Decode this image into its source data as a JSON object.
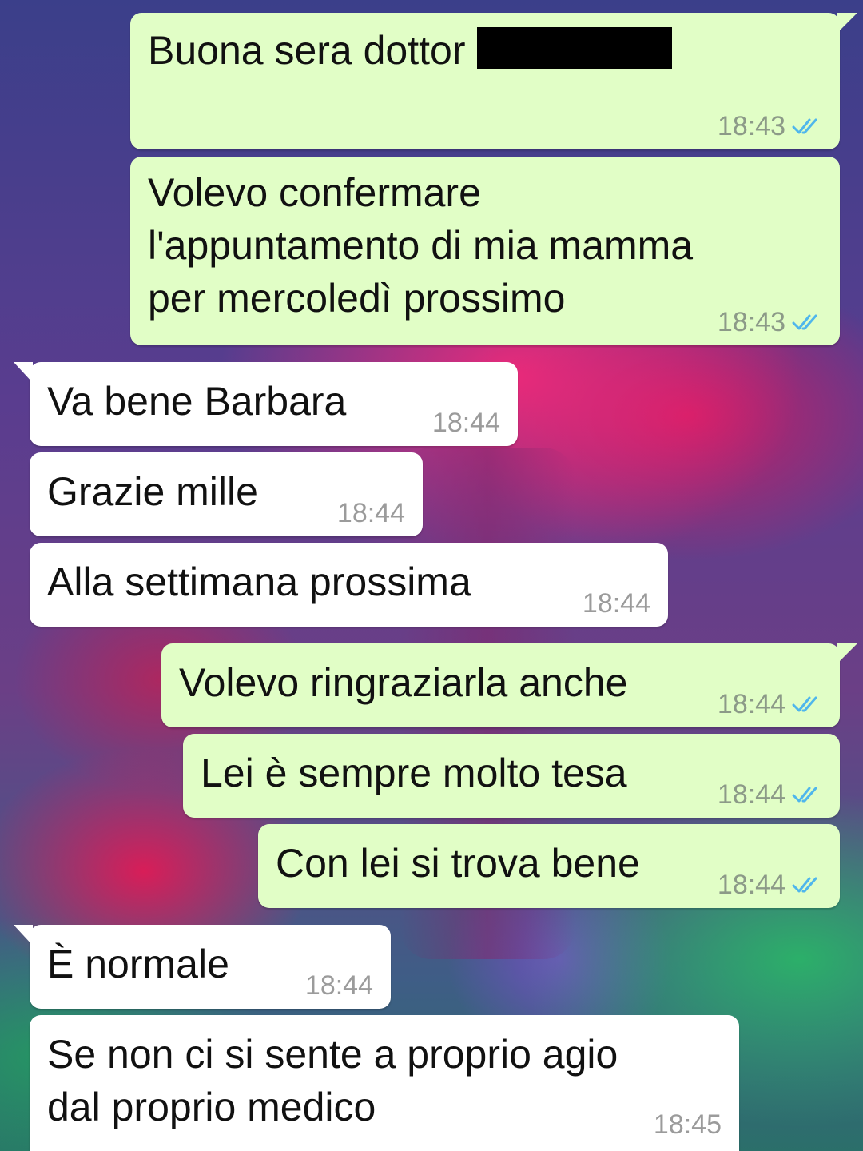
{
  "messages": [
    {
      "dir": "out",
      "text": "Buona sera dottor",
      "time": "18:43",
      "redacted": true
    },
    {
      "dir": "out",
      "text": "Volevo confermare\nl'appuntamento di mia mamma\nper mercoledì prossimo",
      "time": "18:43"
    },
    {
      "dir": "in",
      "text": "Va bene Barbara",
      "time": "18:44"
    },
    {
      "dir": "in",
      "text": "Grazie mille",
      "time": "18:44"
    },
    {
      "dir": "in",
      "text": "Alla settimana prossima",
      "time": "18:44"
    },
    {
      "dir": "out",
      "text": "Volevo ringraziarla anche",
      "time": "18:44"
    },
    {
      "dir": "out",
      "text": "Lei è sempre molto tesa",
      "time": "18:44"
    },
    {
      "dir": "out",
      "text": "Con lei si trova bene",
      "time": "18:44"
    },
    {
      "dir": "in",
      "text": "È normale",
      "time": "18:44"
    },
    {
      "dir": "in",
      "text": "Se non ci si sente a proprio agio\ndal proprio medico",
      "time": "18:45"
    }
  ],
  "colors": {
    "outgoing_bubble": "#e1fec6",
    "incoming_bubble": "#ffffff",
    "read_ticks": "#4fb6ec"
  },
  "icons": {
    "read_receipt": "double-check-icon"
  }
}
